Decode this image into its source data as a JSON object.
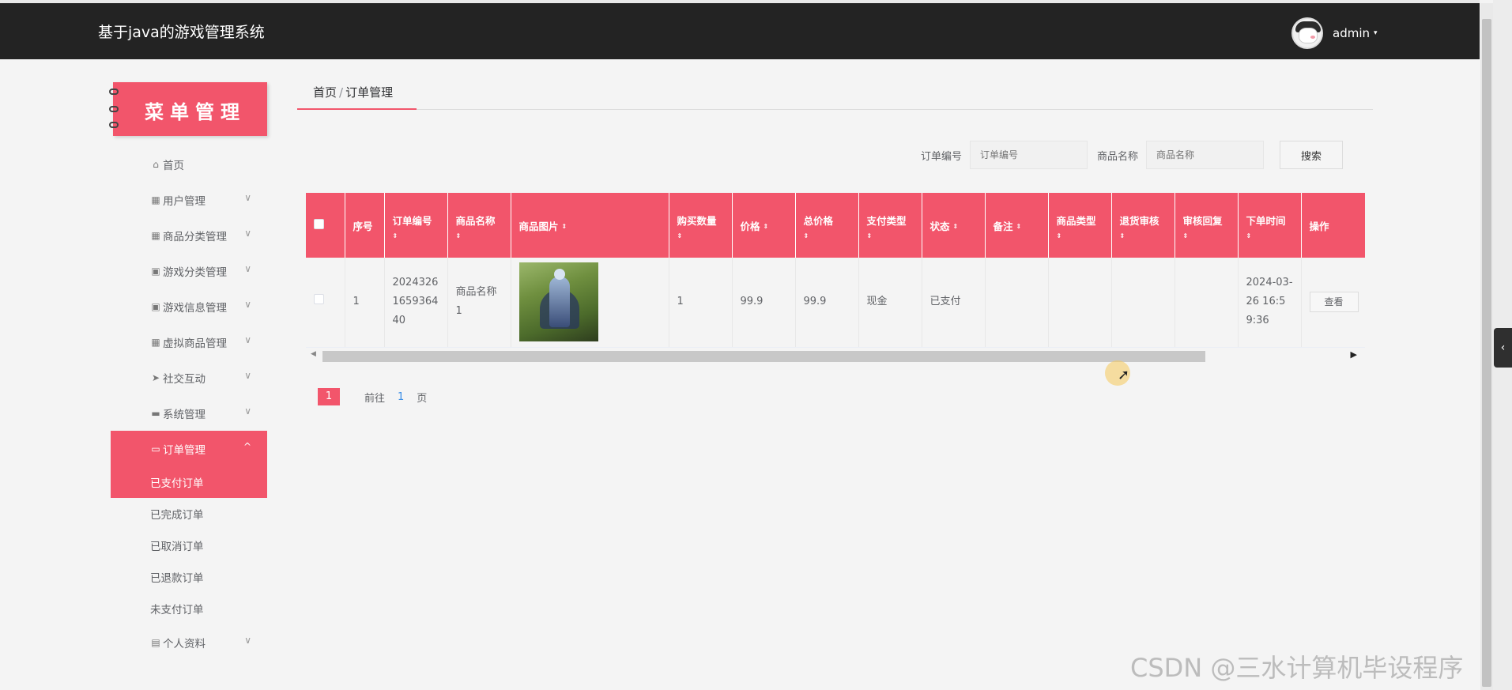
{
  "header": {
    "app_title": "基于java的游戏管理系统",
    "user_name": "admin",
    "caret": "▾"
  },
  "sidebar": {
    "banner_title": "菜单管理",
    "items": [
      {
        "label": "首页",
        "icon": "home-icon",
        "glyph": "⌂",
        "has_arrow": false
      },
      {
        "label": "用户管理",
        "icon": "grid-icon",
        "glyph": "▦",
        "has_arrow": true
      },
      {
        "label": "商品分类管理",
        "icon": "grid-icon",
        "glyph": "▦",
        "has_arrow": true
      },
      {
        "label": "游戏分类管理",
        "icon": "clipboard-icon",
        "glyph": "▣",
        "has_arrow": true
      },
      {
        "label": "游戏信息管理",
        "icon": "clipboard-icon",
        "glyph": "▣",
        "has_arrow": true
      },
      {
        "label": "虚拟商品管理",
        "icon": "apps-icon",
        "glyph": "▦",
        "has_arrow": true
      },
      {
        "label": "社交互动",
        "icon": "send-icon",
        "glyph": "➤",
        "has_arrow": true
      },
      {
        "label": "系统管理",
        "icon": "briefcase-icon",
        "glyph": "▬",
        "has_arrow": true
      }
    ],
    "order_menu": {
      "label": "订单管理",
      "icon": "printer-icon",
      "glyph": "▭",
      "arrow": "^"
    },
    "order_subitems": [
      "已支付订单",
      "已完成订单",
      "已取消订单",
      "已退款订单",
      "未支付订单"
    ],
    "profile_item": {
      "label": "个人资料",
      "icon": "id-card-icon",
      "glyph": "▤"
    },
    "arrow_glyph": "∨"
  },
  "breadcrumb": {
    "home": "首页",
    "separator": "/",
    "current": "订单管理"
  },
  "search": {
    "order_no_label": "订单编号",
    "order_no_placeholder": "订单编号",
    "product_name_label": "商品名称",
    "product_name_placeholder": "商品名称",
    "search_button": "搜索"
  },
  "table": {
    "columns": [
      "序号",
      "订单编号",
      "商品名称",
      "商品图片",
      "购买数量",
      "价格",
      "总价格",
      "支付类型",
      "状态",
      "备注",
      "商品类型",
      "退货审核",
      "审核回复",
      "下单时间",
      "操作"
    ],
    "sort_glyph": "⇕",
    "rows": [
      {
        "index": "1",
        "order_no": "2024326165936440",
        "product_name": "商品名称1",
        "quantity": "1",
        "price": "99.9",
        "total": "99.9",
        "pay_type": "现金",
        "status": "已支付",
        "remark": "",
        "product_type": "",
        "return_review": "",
        "review_reply": "",
        "order_time": "2024-03-26 16:59:36",
        "action": "查看"
      }
    ]
  },
  "pagination": {
    "current_page": "1",
    "goto_label": "前往",
    "goto_value": "1",
    "page_unit": "页"
  },
  "watermark": "CSDN @三水计算机毕设程序",
  "colors": {
    "accent": "#f2556b",
    "topbar": "#232323",
    "background": "#f4f4f4"
  }
}
